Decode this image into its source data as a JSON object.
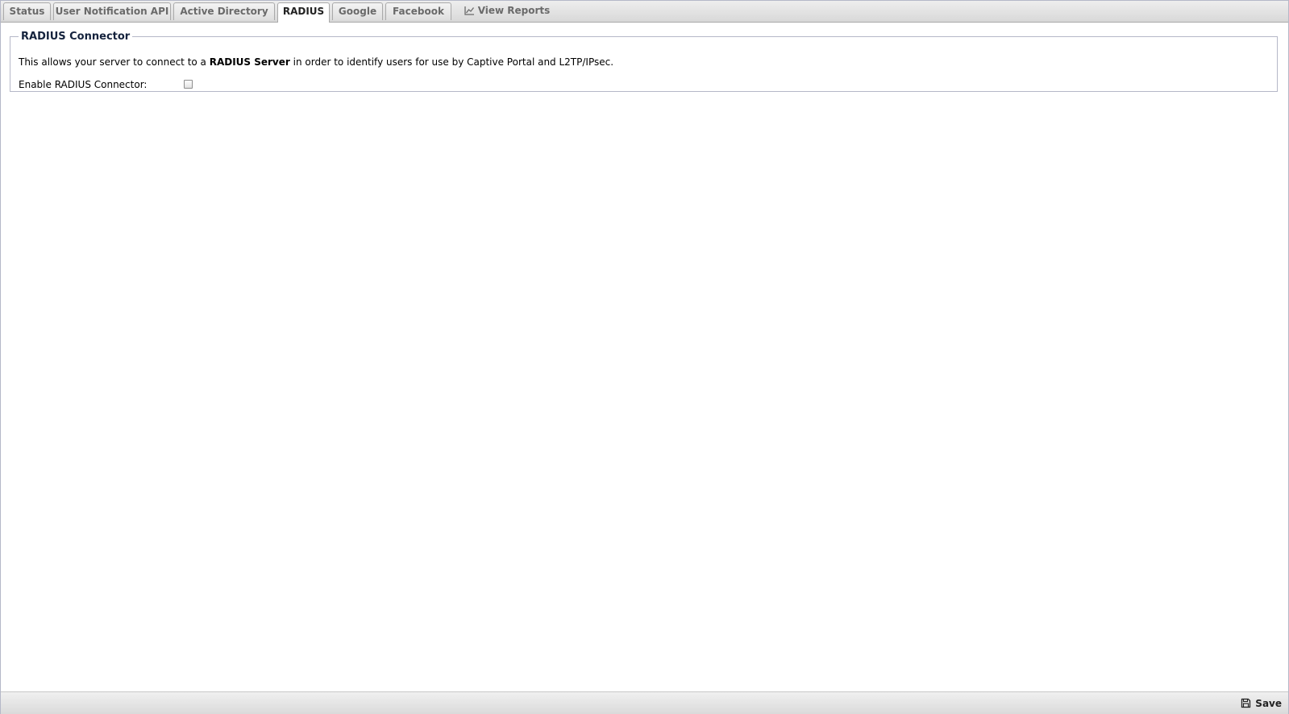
{
  "tabs": [
    {
      "id": "status",
      "label": "Status",
      "active": false
    },
    {
      "id": "user-notification-api",
      "label": "User Notification API",
      "active": false
    },
    {
      "id": "active-directory",
      "label": "Active Directory",
      "active": false
    },
    {
      "id": "radius",
      "label": "RADIUS",
      "active": true
    },
    {
      "id": "google",
      "label": "Google",
      "active": false
    },
    {
      "id": "facebook",
      "label": "Facebook",
      "active": false
    },
    {
      "id": "view-reports",
      "label": "View Reports",
      "active": false,
      "icon": "line-chart-icon"
    }
  ],
  "connector": {
    "legend": "RADIUS Connector",
    "description_before": "This allows your server to connect to a ",
    "description_bold": "RADIUS Server",
    "description_after": " in order to identify users for use by Captive Portal and L2TP/IPsec.",
    "enable_label": "Enable RADIUS Connector:",
    "enabled": false
  },
  "footer": {
    "save_label": "Save",
    "save_icon": "floppy-disk-icon"
  }
}
